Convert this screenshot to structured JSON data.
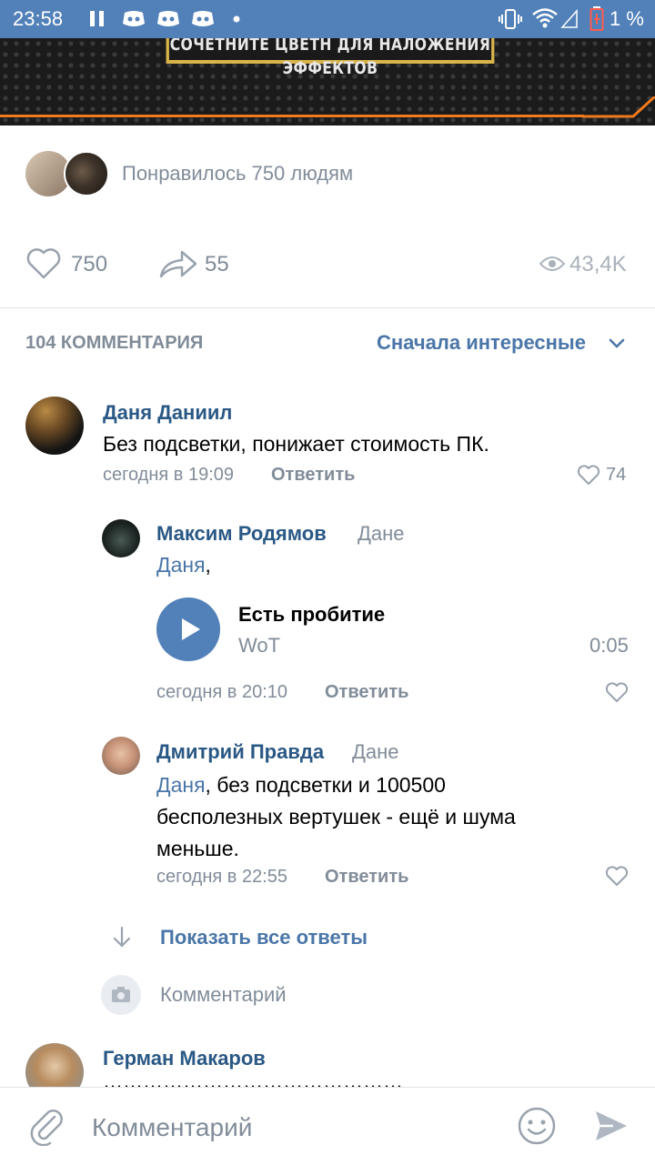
{
  "status_bar": {
    "time": "23:58",
    "battery": "1 %"
  },
  "banner": {
    "text": "СОЧЕТНИТЕ ЦВЕТН ДЛЯ НАЛОЖЕНИЯ ЭФФЕКТОВ"
  },
  "likes_summary": {
    "text": "Понравилось 750 людям"
  },
  "actions": {
    "likes": "750",
    "shares": "55",
    "views": "43,4K"
  },
  "comments_header": {
    "count_label": "104 КОММЕНТАРИЯ",
    "sort_label": "Сначала интересные"
  },
  "comments": [
    {
      "author": "Даня Даниил",
      "text": "Без подсветки, понижает стоимость ПК.",
      "time": "сегодня в 19:09",
      "reply": "Ответить",
      "likes": "74"
    },
    {
      "author": "Максим Родямов",
      "to": "Дане",
      "mention": "Даня",
      "text": ",",
      "audio": {
        "title": "Есть пробитие",
        "artist": "WoT",
        "duration": "0:05"
      },
      "time": "сегодня в 20:10",
      "reply": "Ответить"
    },
    {
      "author": "Дмитрий Правда",
      "to": "Дане",
      "mention": "Даня",
      "text_line1": ", без подсветки и 100500",
      "text_line2": "бесполезных вертушек - ещё и шума",
      "text_line3": "меньше.",
      "time": "сегодня в 22:55",
      "reply": "Ответить"
    },
    {
      "author": "Герман Макаров",
      "text": "………………………………………"
    }
  ],
  "show_all_replies": "Показать все ответы",
  "reply_input_placeholder": "Комментарий",
  "bottom_input": {
    "placeholder": "Комментарий"
  },
  "colors": {
    "accent": "#4a76a8",
    "status_bar": "#5181b8",
    "grey_text": "#818c99",
    "author": "#2a5885"
  }
}
